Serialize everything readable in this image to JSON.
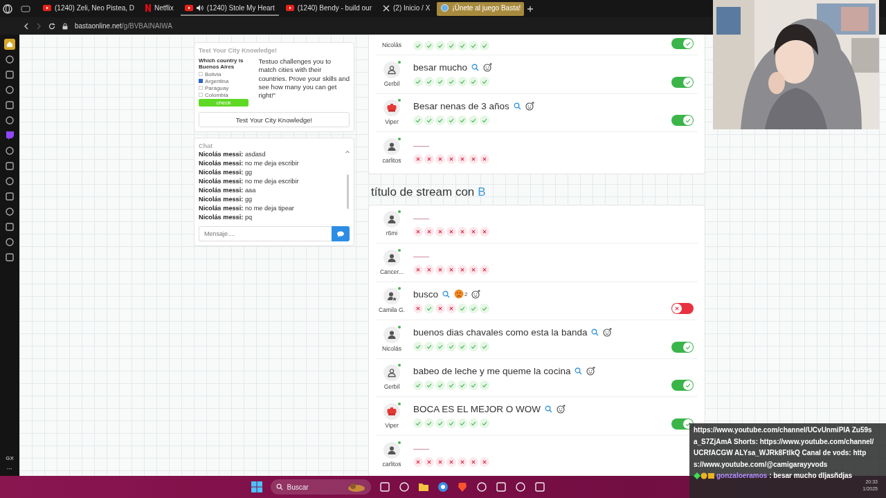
{
  "browser": {
    "tabs": [
      {
        "kind": "youtube",
        "label": "(1240) Zeli, Neo Pistea, D",
        "selected": false,
        "audio": false
      },
      {
        "kind": "netflix",
        "label": "Netflix",
        "selected": false,
        "audio": false
      },
      {
        "kind": "youtube",
        "label": "(1240) Stole My Heart",
        "selected": false,
        "audio": true
      },
      {
        "kind": "youtube",
        "label": "(1240) Bendy - build our",
        "selected": false,
        "audio": false
      },
      {
        "kind": "x",
        "label": "(2) Inicio / X",
        "selected": false,
        "audio": false
      },
      {
        "kind": "basta",
        "label": "¡Únete al juego Basta!",
        "selected": true,
        "audio": false
      }
    ],
    "url_host": "bastaonline.net",
    "url_path": "/g/BVBAINAIWA"
  },
  "sidebar": {
    "bottom_label": "GX",
    "more": "···"
  },
  "promo": {
    "title": "Test Your City Knowledge!",
    "quiz": {
      "question": "Which country is Buenos Aires",
      "options": [
        {
          "label": "Bolivia",
          "checked": false
        },
        {
          "label": "Argentina",
          "checked": true
        },
        {
          "label": "Paraguay",
          "checked": false
        },
        {
          "label": "Colombia",
          "checked": false
        }
      ],
      "button": "check"
    },
    "text": "Testuo challenges you to match cities with their countries. Prove your skills and see how many you can get right!\"",
    "button": "Test Your City Knowledge!"
  },
  "chat": {
    "title": "Chat",
    "messages": [
      {
        "user": "Nicolás messi:",
        "text": "asdasd"
      },
      {
        "user": "Nicolás messi:",
        "text": "no me deja escribir"
      },
      {
        "user": "Nicolás messi:",
        "text": "gg"
      },
      {
        "user": "Nicolás messi:",
        "text": "no me deja escribir"
      },
      {
        "user": "Nicolás messi:",
        "text": "aaa"
      },
      {
        "user": "Nicolás messi:",
        "text": "gg"
      },
      {
        "user": "Nicolás messi:",
        "text": "no me deja tipear"
      },
      {
        "user": "Nicolás messi:",
        "text": "pq"
      }
    ],
    "placeholder": "Mensaje...."
  },
  "categories": [
    {
      "rows": [
        {
          "player": "Nicolás",
          "partial": true,
          "votes": [
            true,
            true,
            true,
            true,
            true,
            true,
            true
          ],
          "valid": true
        },
        {
          "kind": "outline",
          "player": "Gerbil",
          "answer": "besar mucho",
          "votes": [
            true,
            true,
            true,
            true,
            true,
            true,
            true
          ],
          "valid": true
        },
        {
          "kind": "stop",
          "player": "Viper",
          "answer": "Besar nenas de 3 años",
          "votes": [
            true,
            true,
            true,
            true,
            true,
            true,
            true
          ],
          "valid": true
        },
        {
          "kind": "person",
          "player": "carlitos",
          "votes": [
            false,
            false,
            false,
            false,
            false,
            false,
            false
          ]
        }
      ]
    },
    {
      "title": "título de stream con",
      "letter": "B",
      "rows": [
        {
          "kind": "person",
          "player": "r6mi",
          "votes": [
            false,
            false,
            false,
            false,
            false,
            false,
            false
          ]
        },
        {
          "kind": "person",
          "player": "Cancer...",
          "votes": [
            false,
            false,
            false,
            false,
            false,
            false,
            false
          ]
        },
        {
          "kind": "star",
          "player": "Camila G.",
          "answer": "busco",
          "reaction_count": "2",
          "votes": [
            false,
            true,
            false,
            false,
            true,
            true,
            true
          ],
          "valid": false
        },
        {
          "kind": "person",
          "player": "Nicolás",
          "answer": "buenos dias chavales como esta la banda",
          "votes": [
            true,
            true,
            true,
            true,
            true,
            true,
            true
          ],
          "valid": true
        },
        {
          "kind": "outline",
          "player": "Gerbil",
          "answer": "babeo de leche y me queme la cocina",
          "votes": [
            true,
            true,
            true,
            true,
            true,
            true,
            true
          ],
          "valid": true
        },
        {
          "kind": "stop",
          "player": "Viper",
          "answer": "BOCA ES EL MEJOR O WOW",
          "votes": [
            true,
            true,
            true,
            true,
            true,
            true,
            true
          ],
          "valid": true
        },
        {
          "kind": "person",
          "player": "carlitos",
          "votes": [
            false,
            false,
            false,
            false,
            false,
            false,
            false
          ]
        }
      ]
    }
  ],
  "stream_chat": {
    "info": "https://www.youtube.com/channel/UCvUnmiPIA Zu59sa_S7ZjAmA Shorts: https://www.youtube.com/channel/UCRfACGW ALYsa_WJRk8FtlkQ Canal de vods: https://www.youtube.com/@camigarayyvods",
    "user": "gonzaloeramos",
    "message": ": besar mucho dljasñdjas"
  },
  "taskbar": {
    "search_placeholder": "Buscar",
    "time": "20:33",
    "date": "1/2025"
  }
}
